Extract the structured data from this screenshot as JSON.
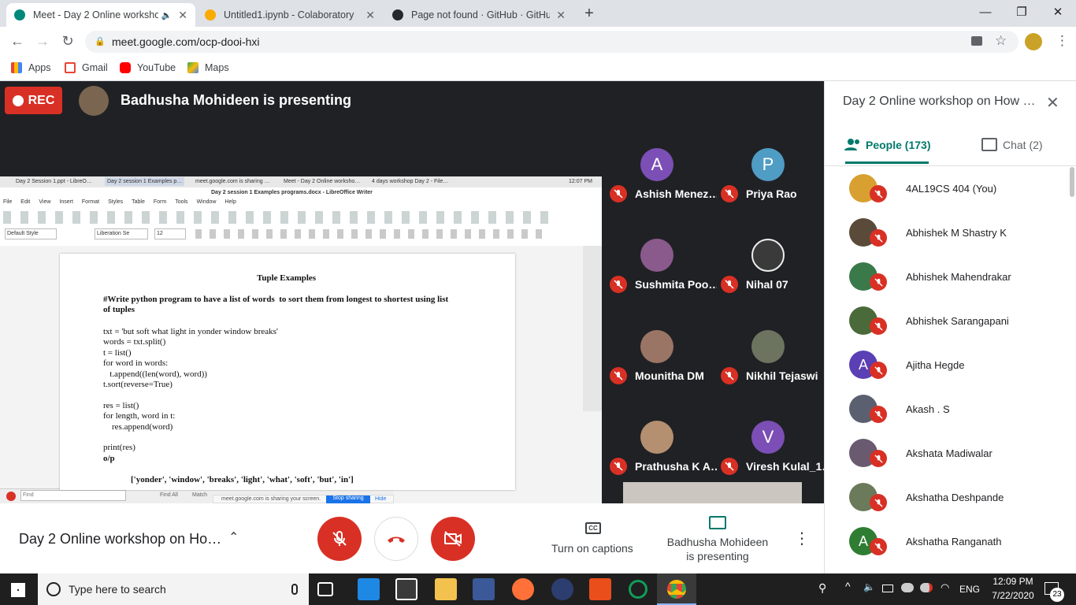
{
  "browser": {
    "tabs": [
      {
        "title": "Meet - Day 2 Online worksho",
        "favicon_color": "#00897b",
        "active": true
      },
      {
        "title": "Untitled1.ipynb - Colaboratory",
        "favicon_color": "#f9ab00",
        "active": false
      },
      {
        "title": "Page not found · GitHub · GitHub",
        "favicon_color": "#24292e",
        "active": false
      }
    ],
    "url": "meet.google.com/ocp-dooi-hxi",
    "bookmarks": [
      "Apps",
      "Gmail",
      "YouTube",
      "Maps"
    ]
  },
  "meet": {
    "rec_label": "REC",
    "presenting_text": "Badhusha Mohideen is presenting",
    "tiles": [
      {
        "name": "Ashish Menez…",
        "initial": "A",
        "color": "#7b4fb5"
      },
      {
        "name": "Priya Rao",
        "initial": "P",
        "color": "#4f9cc4"
      },
      {
        "name": "Sushmita Poo…",
        "initial": "",
        "color": "#8a5a8c"
      },
      {
        "name": "Nihal 07",
        "initial": "",
        "color": "#3a3a3a"
      },
      {
        "name": "Mounitha DM",
        "initial": "",
        "color": "#9a7566"
      },
      {
        "name": "Nikhil Tejaswi",
        "initial": "",
        "color": "#6c7460"
      },
      {
        "name": "Prathusha K A…",
        "initial": "",
        "color": "#b49070"
      },
      {
        "name": "Viresh Kulal_1…",
        "initial": "V",
        "color": "#7b4fb5"
      }
    ],
    "meeting_title": "Day 2 Online workshop on Ho…",
    "captions_label": "Turn on captions",
    "presenting_label": "Badhusha Mohideen is presenting"
  },
  "shared_screen": {
    "os_tabs": [
      "Day 2 Session 1.ppt - LibreO…",
      "Day 2 session 1 Examples p…",
      "meet.google.com is sharing …",
      "Meet - Day 2 Online worksho…",
      "4 days workshop Day 2 - File…"
    ],
    "clock": "12:07 PM",
    "window_title": "Day 2 session 1 Examples programs.docx - LibreOffice Writer",
    "menu": [
      "File",
      "Edit",
      "View",
      "Insert",
      "Format",
      "Styles",
      "Table",
      "Form",
      "Tools",
      "Window",
      "Help"
    ],
    "style_box": "Default Style",
    "font_box": "Liberation Se",
    "size_box": "12",
    "doc_title": "Tuple Examples",
    "doc_heading": "#Write python program to have a list of words  to sort them from longest to shortest using list\nof tuples",
    "doc_code": "txt = 'but soft what light in yonder window breaks'\nwords = txt.split()\nt = list()\nfor word in words:\n   t.append((len(word), word))\nt.sort(reverse=True)\n\nres = list()\nfor length, word in t:\n    res.append(word)\n\nprint(res)",
    "doc_output_label": "o/p",
    "doc_output": "['yonder', 'window', 'breaks', 'light', 'what', 'soft', 'but', 'in']",
    "find_placeholder": "Find",
    "find_all": "Find All",
    "match_case": "Match",
    "sharing_notice": "meet.google.com is sharing your screen.",
    "stop_sharing": "Stop sharing",
    "hide": "Hide"
  },
  "panel": {
    "title": "Day 2 Online workshop on How …",
    "people_tab": "People (173)",
    "chat_tab": "Chat (2)",
    "people": [
      {
        "name": "4AL19CS 404 (You)",
        "initial": "",
        "color": "#d8a030"
      },
      {
        "name": "Abhishek M Shastry K",
        "initial": "",
        "color": "#5a4a3a"
      },
      {
        "name": "Abhishek Mahendrakar",
        "initial": "",
        "color": "#3a7a4a"
      },
      {
        "name": "Abhishek Sarangapani",
        "initial": "",
        "color": "#4a6a3a"
      },
      {
        "name": "Ajitha Hegde",
        "initial": "A",
        "color": "#5b3fb5"
      },
      {
        "name": "Akash . S",
        "initial": "",
        "color": "#5a6070"
      },
      {
        "name": "Akshata Madiwalar",
        "initial": "",
        "color": "#6a5a70"
      },
      {
        "name": "Akshatha Deshpande",
        "initial": "",
        "color": "#6a7a5a"
      },
      {
        "name": "Akshatha Ranganath",
        "initial": "A",
        "color": "#2e7d32"
      }
    ]
  },
  "taskbar": {
    "search_placeholder": "Type here to search",
    "time": "12:09 PM",
    "date": "7/22/2020",
    "lang": "ENG",
    "notif_count": "23"
  }
}
